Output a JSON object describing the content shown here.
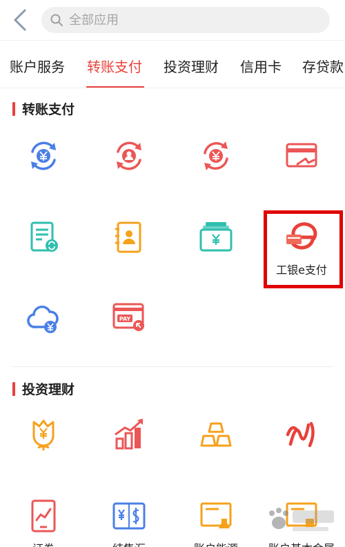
{
  "search": {
    "placeholder": "全部应用"
  },
  "tabs": [
    {
      "label": "账户服务"
    },
    {
      "label": "转账支付"
    },
    {
      "label": "投资理财"
    },
    {
      "label": "信用卡"
    },
    {
      "label": "存贷款"
    }
  ],
  "sections": [
    {
      "title": "转账支付"
    },
    {
      "title": "投资理财"
    }
  ],
  "transfer_items": [
    {
      "label": "",
      "icon": "yen-exchange-icon"
    },
    {
      "label": "",
      "icon": "person-exchange-icon"
    },
    {
      "label": "",
      "icon": "yen-refresh-icon"
    },
    {
      "label": "",
      "icon": "card-transfer-icon"
    },
    {
      "label": "",
      "icon": "bill-refresh-icon"
    },
    {
      "label": "",
      "icon": "contact-book-icon"
    },
    {
      "label": "",
      "icon": "yen-wallet-icon"
    },
    {
      "label": "工银e支付",
      "icon": "e-pay-icon"
    },
    {
      "label": "",
      "icon": "cloud-yen-icon"
    },
    {
      "label": "",
      "icon": "pay-card-icon"
    }
  ],
  "invest_items": [
    {
      "label": "",
      "icon": "yen-flower-icon"
    },
    {
      "label": "",
      "icon": "growth-chart-icon"
    },
    {
      "label": "",
      "icon": "gold-bars-icon"
    },
    {
      "label": "",
      "icon": "infinity-logo-icon"
    },
    {
      "label": "证券",
      "icon": "stock-tablet-icon"
    },
    {
      "label": "结售汇",
      "icon": "currency-exchange-icon"
    },
    {
      "label": "账户能源",
      "icon": "energy-board-icon"
    },
    {
      "label": "账户基本金属",
      "icon": "metal-board-icon"
    }
  ],
  "colors": {
    "accent": "#e8413a",
    "blue": "#4a7fe6",
    "orange": "#f5a11c",
    "teal": "#2fbfae",
    "highlight": "#e00000"
  }
}
